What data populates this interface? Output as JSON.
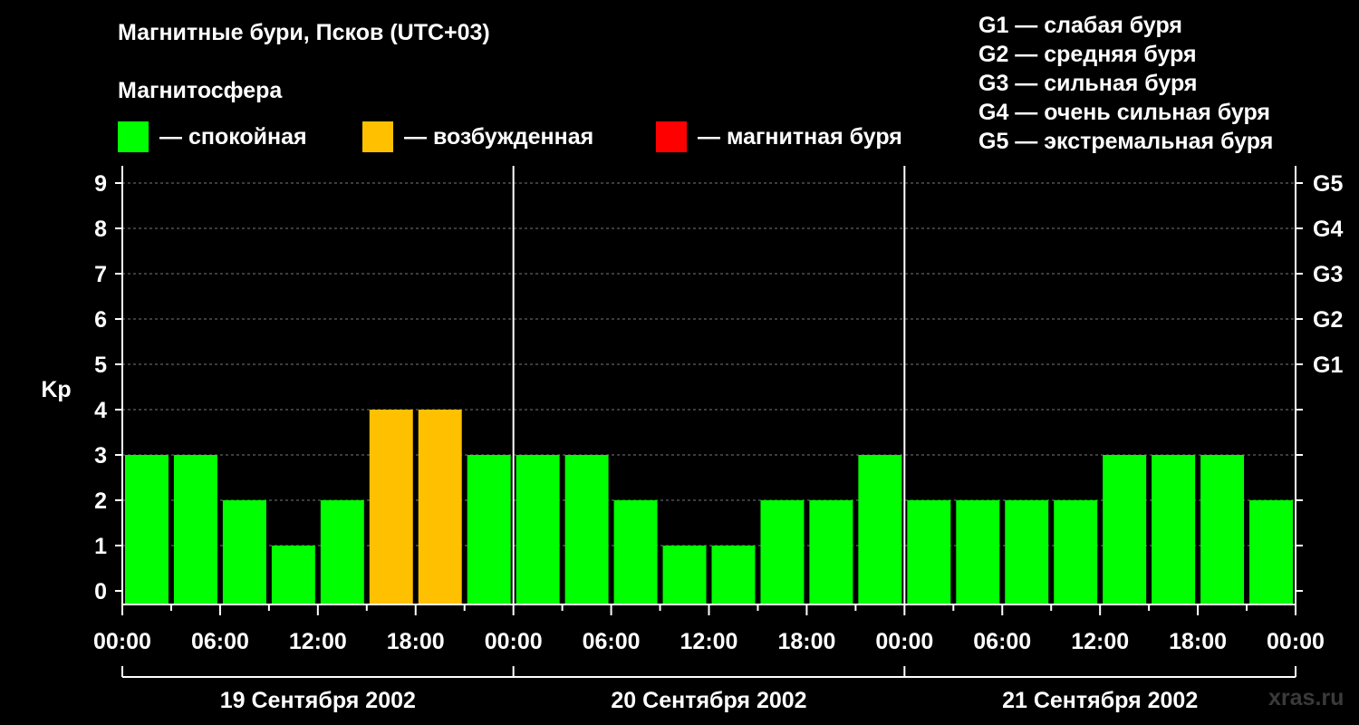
{
  "title": "Магнитные бури, Псков (UTC+03)",
  "section_label": "Магнитосфера",
  "legend": [
    {
      "color": "#00ff00",
      "label": "— спокойная"
    },
    {
      "color": "#ffc000",
      "label": "— возбужденная"
    },
    {
      "color": "#ff0000",
      "label": "— магнитная буря"
    }
  ],
  "g_scale": [
    "G1 — слабая буря",
    "G2 — средняя буря",
    "G3 — сильная буря",
    "G4 — очень сильная буря",
    "G5 — экстремальная буря"
  ],
  "watermark": "xras.ru",
  "chart_data": {
    "type": "bar",
    "ylabel": "Kp",
    "ylim": [
      0,
      9
    ],
    "yticks": [
      0,
      1,
      2,
      3,
      4,
      5,
      6,
      7,
      8,
      9
    ],
    "right_axis_labels": [
      {
        "kp": 5,
        "label": "G1"
      },
      {
        "kp": 6,
        "label": "G2"
      },
      {
        "kp": 7,
        "label": "G3"
      },
      {
        "kp": 8,
        "label": "G4"
      },
      {
        "kp": 9,
        "label": "G5"
      }
    ],
    "grid": true,
    "xtick_labels": [
      "00:00",
      "06:00",
      "12:00",
      "18:00",
      "00:00",
      "06:00",
      "12:00",
      "18:00",
      "00:00",
      "06:00",
      "12:00",
      "18:00",
      "00:00"
    ],
    "days": [
      "19 Сентября 2002",
      "20 Сентября 2002",
      "21 Сентября 2002"
    ],
    "interval_hours": 3,
    "values": [
      3,
      3,
      2,
      1,
      2,
      4,
      4,
      3,
      3,
      3,
      2,
      1,
      1,
      2,
      2,
      3,
      2,
      2,
      2,
      2,
      3,
      3,
      3,
      2
    ],
    "colors": [
      "#00ff00",
      "#00ff00",
      "#00ff00",
      "#00ff00",
      "#00ff00",
      "#ffc000",
      "#ffc000",
      "#00ff00",
      "#00ff00",
      "#00ff00",
      "#00ff00",
      "#00ff00",
      "#00ff00",
      "#00ff00",
      "#00ff00",
      "#00ff00",
      "#00ff00",
      "#00ff00",
      "#00ff00",
      "#00ff00",
      "#00ff00",
      "#00ff00",
      "#00ff00",
      "#00ff00"
    ]
  }
}
